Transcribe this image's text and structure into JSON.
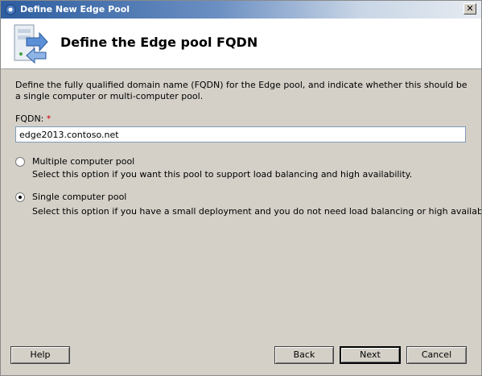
{
  "window": {
    "title": "Define New Edge Pool",
    "close_glyph": "✕"
  },
  "header": {
    "title": "Define the Edge pool FQDN",
    "icon": "server-arrow-icon"
  },
  "description": "Define the fully qualified domain name (FQDN) for the Edge pool, and indicate whether this should be a single computer or multi-computer pool.",
  "fqdn": {
    "label": "FQDN:",
    "required_marker": "*",
    "value": "edge2013.contoso.net"
  },
  "options": [
    {
      "label": "Multiple computer pool",
      "description": "Select this option if you want this pool to support load balancing and high availability.",
      "selected": false
    },
    {
      "label": "Single computer pool",
      "description": "Select this option if you have a small deployment and you do not need load balancing or high availability.",
      "selected": true
    }
  ],
  "buttons": {
    "help": "Help",
    "back": "Back",
    "next": "Next",
    "cancel": "Cancel"
  },
  "colors": {
    "title_bar_start": "#2d5d9f",
    "dialog_background": "#d4d0c8",
    "required_marker": "#d00000"
  }
}
